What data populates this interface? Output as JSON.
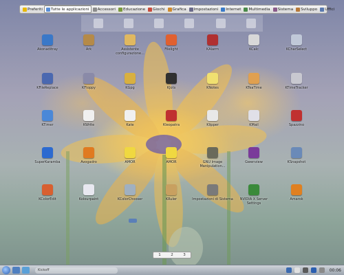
{
  "tabs": [
    {
      "label": "Preferiti",
      "color": "#e8b800"
    },
    {
      "label": "Tutte le applicazioni",
      "color": "#5b8fd6",
      "active": true
    },
    {
      "label": "Accessori",
      "color": "#8c8c8c"
    },
    {
      "label": "Educazione",
      "color": "#7a9a3c"
    },
    {
      "label": "Giochi",
      "color": "#c84c3c"
    },
    {
      "label": "Grafica",
      "color": "#d08a2c"
    },
    {
      "label": "Impostazioni",
      "color": "#6a6a8a"
    },
    {
      "label": "Internet",
      "color": "#3a7ac8"
    },
    {
      "label": "Multimedia",
      "color": "#4a8a4a"
    },
    {
      "label": "Sistema",
      "color": "#8a5a8a"
    },
    {
      "label": "Sviluppo",
      "color": "#b87a3a"
    },
    {
      "label": "Uffici",
      "color": "#5a7ab0"
    }
  ],
  "apps": [
    {
      "label": "Akonaditray",
      "icon": "akonadi-icon",
      "color": "#3a78c8"
    },
    {
      "label": "Ark",
      "icon": "archive-icon",
      "color": "#b58a48"
    },
    {
      "label": "Assistente configurazione...",
      "icon": "wizard-icon",
      "color": "#e0b860"
    },
    {
      "label": "Filelight",
      "icon": "filelight-icon",
      "color": "#e06030"
    },
    {
      "label": "KAlarm",
      "icon": "alarm-icon",
      "color": "#b03030"
    },
    {
      "label": "KCalc",
      "icon": "calculator-icon",
      "color": "#d8d8d8"
    },
    {
      "label": "KCharSelect",
      "icon": "charselect-icon",
      "color": "#c0c8d8"
    },
    {
      "label": "KFileReplace",
      "icon": "filereplace-icon",
      "color": "#4a68b0"
    },
    {
      "label": "KFloppy",
      "icon": "floppy-icon",
      "color": "#8a8aa8"
    },
    {
      "label": "KGpg",
      "icon": "lock-icon",
      "color": "#d8b040"
    },
    {
      "label": "KJots",
      "icon": "notebook-icon",
      "color": "#303030"
    },
    {
      "label": "KNotes",
      "icon": "notes-icon",
      "color": "#f0e070"
    },
    {
      "label": "KTeaTime",
      "icon": "tea-icon",
      "color": "#e0a050"
    },
    {
      "label": "KTimeTracker",
      "icon": "timetracker-icon",
      "color": "#c8c8d0"
    },
    {
      "label": "KTimer",
      "icon": "timer-icon",
      "color": "#4a88d8"
    },
    {
      "label": "KWrite",
      "icon": "write-icon",
      "color": "#f0f0f0"
    },
    {
      "label": "Kate",
      "icon": "kate-icon",
      "color": "#f0f0f0"
    },
    {
      "label": "Kleopatra",
      "icon": "kleopatra-icon",
      "color": "#c03030"
    },
    {
      "label": "Klipper",
      "icon": "clipboard-icon",
      "color": "#e8e8e8"
    },
    {
      "label": "KMail",
      "icon": "mail-icon",
      "color": "#e0e0e8"
    },
    {
      "label": "Spazzino",
      "icon": "cleaner-icon",
      "color": "#c03030"
    },
    {
      "label": "SuperKaramba",
      "icon": "karamba-icon",
      "color": "#2c6ad0"
    },
    {
      "label": "Avogadro",
      "icon": "molecule-icon",
      "color": "#e07a20"
    },
    {
      "label": "AMOR",
      "icon": "smiley-icon",
      "color": "#f0d840"
    },
    {
      "label": "AMOR",
      "icon": "smiley-icon",
      "color": "#f0d840"
    },
    {
      "label": "GNU Image Manipulation...",
      "icon": "gimp-icon",
      "color": "#6a6a5a"
    },
    {
      "label": "Gwenview",
      "icon": "eye-icon",
      "color": "#7a3a9a"
    },
    {
      "label": "KSnapshot",
      "icon": "snapshot-icon",
      "color": "#6a8ab8"
    },
    {
      "label": "KColorEdit",
      "icon": "paint-icon",
      "color": "#d86030"
    },
    {
      "label": "Kolourpaint",
      "icon": "kolourpaint-icon",
      "color": "#e8e8f0"
    },
    {
      "label": "KColorChooser",
      "icon": "colorpicker-icon",
      "color": "#a0b0c0"
    },
    {
      "label": "KRuler",
      "icon": "ruler-icon",
      "color": "#c8a060"
    },
    {
      "label": "Impostazioni di Sistema",
      "icon": "settings-icon",
      "color": "#7a7a7a"
    },
    {
      "label": "NVIDIA X Server Settings",
      "icon": "nvidia-icon",
      "color": "#3a8a3a"
    },
    {
      "label": "Amarok",
      "icon": "amarok-icon",
      "color": "#e08020"
    }
  ],
  "pager": [
    "1",
    "2",
    "3"
  ],
  "taskbar": {
    "search": "Kickoff"
  },
  "clock": "00:06"
}
